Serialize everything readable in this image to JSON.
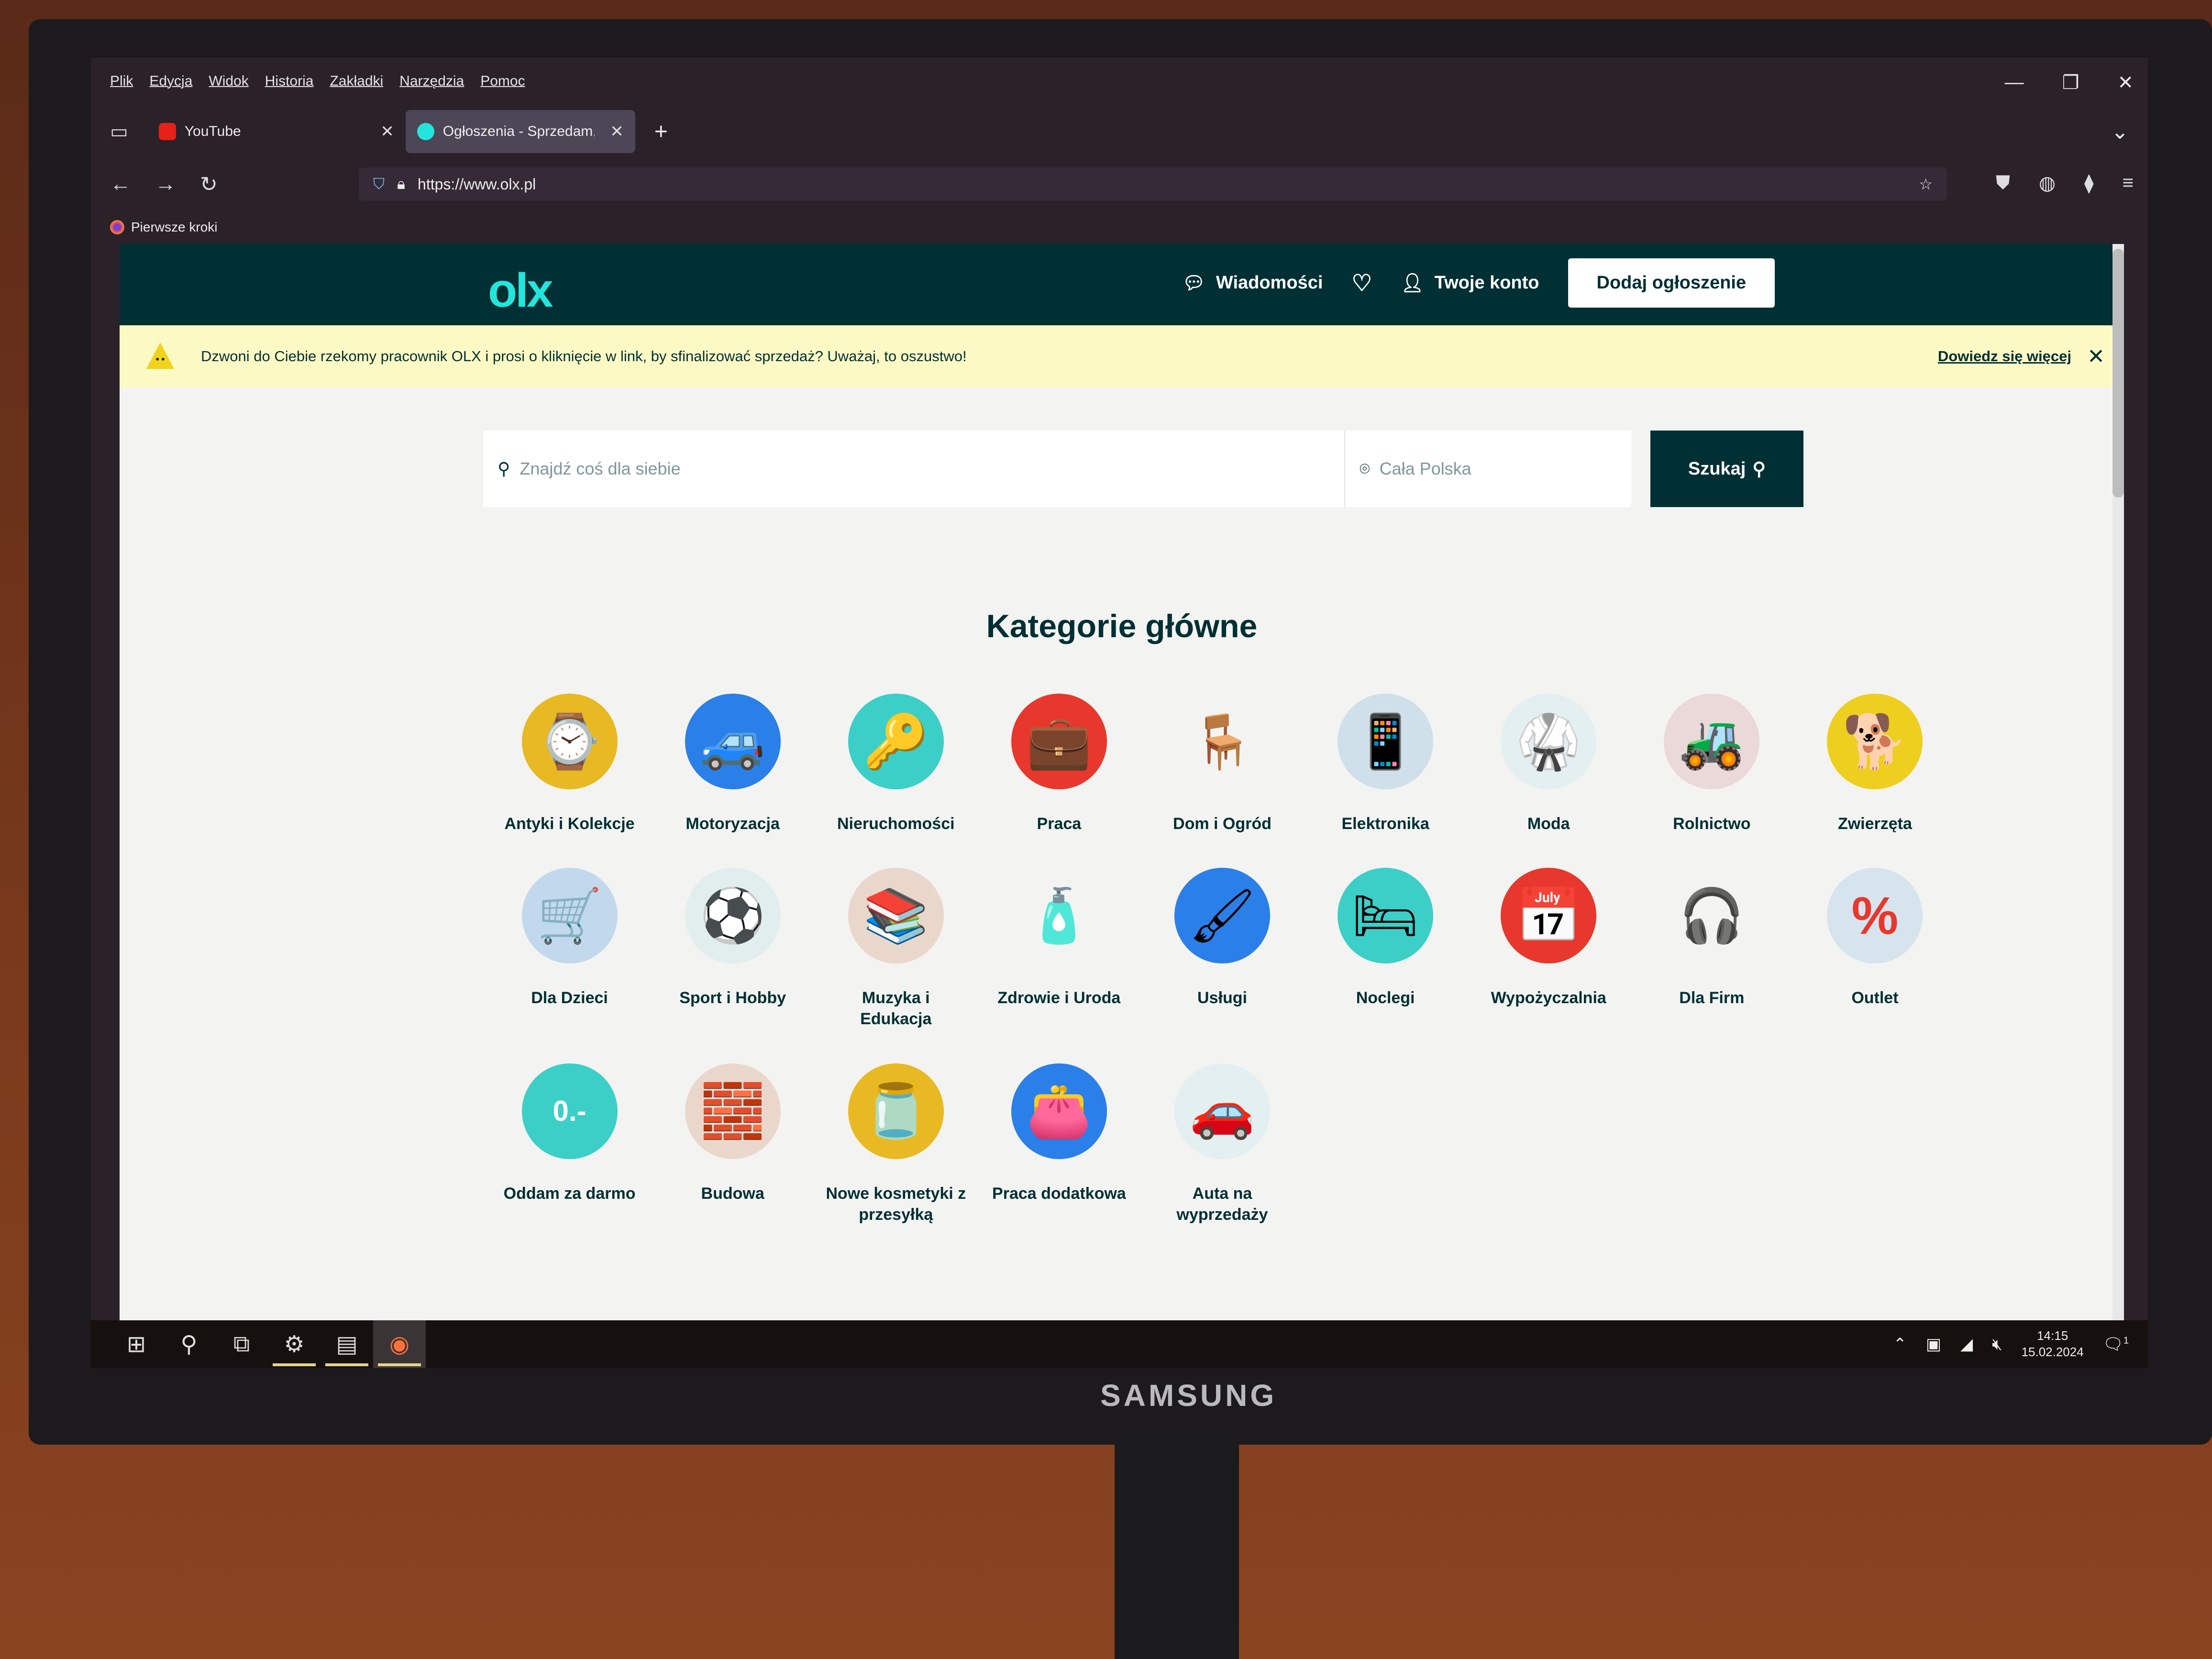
{
  "browser": {
    "menu": [
      "Plik",
      "Edycja",
      "Widok",
      "Historia",
      "Zakładki",
      "Narzędzia",
      "Pomoc"
    ],
    "tabs": [
      {
        "title": "YouTube",
        "active": false,
        "favicon_color": "#e62117"
      },
      {
        "title": "Ogłoszenia - Sprzedam, kupię n",
        "active": true,
        "favicon_color": "#23e5db"
      }
    ],
    "new_tab_label": "+",
    "url": "https://www.olx.pl",
    "bookmarks": [
      {
        "label": "Pierwsze kroki"
      }
    ],
    "window_controls": {
      "minimize": "—",
      "restore": "❐",
      "close": "✕"
    },
    "tab_list_icon": "⌄"
  },
  "olx": {
    "logo": "olx",
    "nav": {
      "messages": "Wiadomości",
      "account": "Twoje konto",
      "add_listing": "Dodaj ogłoszenie"
    },
    "alert": {
      "text": "Dzwoni do Ciebie rzekomy pracownik OLX i prosi o kliknięcie w link, by sfinalizować sprzedaż? Uważaj, to oszustwo!",
      "learn_more": "Dowiedz się więcej",
      "close": "✕"
    },
    "search": {
      "placeholder": "Znajdź coś dla siebie",
      "location_placeholder": "Cała Polska",
      "button": "Szukaj"
    },
    "categories_title": "Kategorie główne",
    "categories": [
      {
        "label": "Antyki i Kolekcje",
        "icon": "⌚",
        "color": "#e8b923"
      },
      {
        "label": "Motoryzacja",
        "icon": "🚙",
        "color": "#2b7fe8"
      },
      {
        "label": "Nieruchomości",
        "icon": "🔑",
        "color": "#3ccfc8"
      },
      {
        "label": "Praca",
        "icon": "💼",
        "color": "#e8372c"
      },
      {
        "label": "Dom i Ogród",
        "icon": "🪑",
        "color": "#f3f4f1"
      },
      {
        "label": "Elektronika",
        "icon": "📱",
        "color": "#cfe0ea"
      },
      {
        "label": "Moda",
        "icon": "🥋",
        "color": "#e3eff1"
      },
      {
        "label": "Rolnictwo",
        "icon": "🚜",
        "color": "#ead9d8"
      },
      {
        "label": "Zwierzęta",
        "icon": "🐕",
        "color": "#eecf1f"
      },
      {
        "label": "Dla Dzieci",
        "icon": "🛒",
        "color": "#c2d8ec"
      },
      {
        "label": "Sport i Hobby",
        "icon": "⚽",
        "color": "#e2eeee"
      },
      {
        "label": "Muzyka i Edukacja",
        "icon": "📚",
        "color": "#ead7cc"
      },
      {
        "label": "Zdrowie i Uroda",
        "icon": "🧴",
        "color": "#f3f4f1"
      },
      {
        "label": "Usługi",
        "icon": "🖌",
        "color": "#2b7fe8"
      },
      {
        "label": "Noclegi",
        "icon": "🛏",
        "color": "#3ccfc8"
      },
      {
        "label": "Wypożyczalnia",
        "icon": "📅",
        "color": "#e8372c"
      },
      {
        "label": "Dla Firm",
        "icon": "🎧",
        "color": "#f3f4f1"
      },
      {
        "label": "Outlet",
        "icon": "%",
        "color": "#d6e4ee"
      },
      {
        "label": "Oddam za darmo",
        "icon": "0.-",
        "color": "#3ccfc8"
      },
      {
        "label": "Budowa",
        "icon": "🧱",
        "color": "#ead7cc"
      },
      {
        "label": "Nowe kosmetyki z przesyłką",
        "icon": "🫙",
        "color": "#e8b923"
      },
      {
        "label": "Praca dodatkowa",
        "icon": "👛",
        "color": "#2b7fe8"
      },
      {
        "label": "Auta na wyprzedaży",
        "icon": "🚗",
        "color": "#e3eff1"
      }
    ]
  },
  "taskbar": {
    "icons": [
      {
        "name": "windows-start-icon",
        "glyph": "⊞",
        "running": false,
        "active": false
      },
      {
        "name": "search-icon",
        "glyph": "⚲",
        "running": false,
        "active": false
      },
      {
        "name": "task-view-icon",
        "glyph": "⧉",
        "running": false,
        "active": false
      },
      {
        "name": "settings-icon",
        "glyph": "⚙",
        "running": true,
        "active": false
      },
      {
        "name": "app-icon",
        "glyph": "▤",
        "running": true,
        "active": false
      },
      {
        "name": "firefox-icon",
        "glyph": "◉",
        "running": true,
        "active": true
      }
    ],
    "time": "14:15",
    "date": "15.02.2024",
    "notifications": "1"
  },
  "monitor": {
    "brand": "SAMSUNG"
  }
}
